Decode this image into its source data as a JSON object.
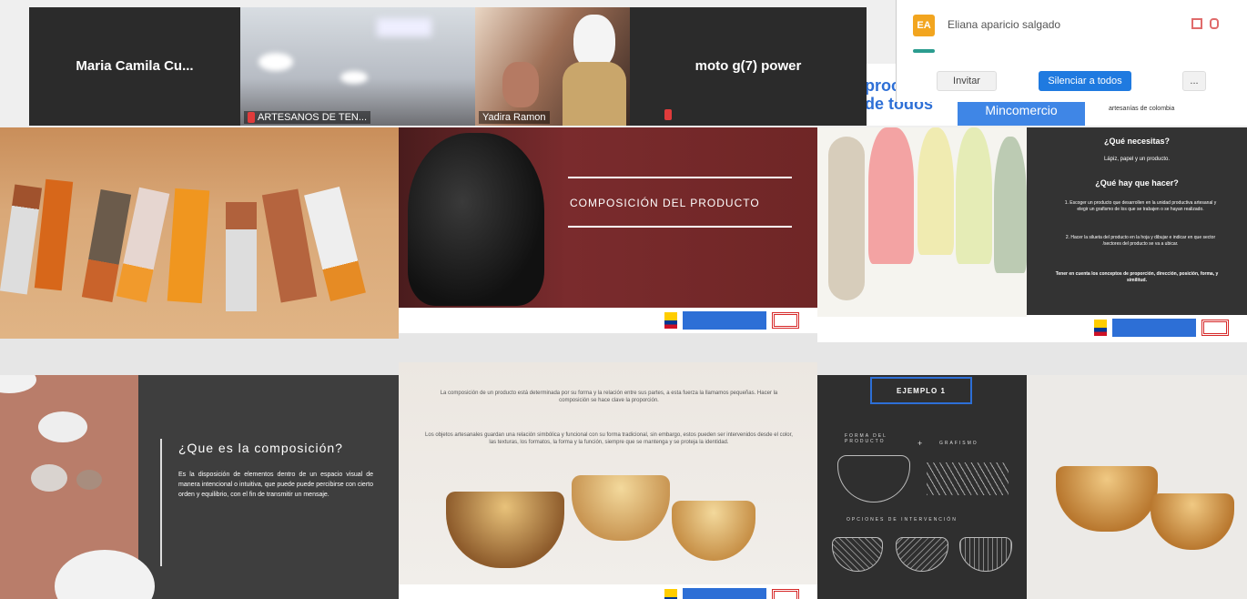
{
  "gallery": {
    "tiles": [
      {
        "name": "Maria Camila Cu..."
      },
      {
        "label": "ARTESANOS DE TEN..."
      },
      {
        "label": "Yadira Ramon"
      },
      {
        "name": "moto g(7) power"
      }
    ]
  },
  "participants": {
    "initials": "EA",
    "name": "Eliana aparicio salgado",
    "invite": "Invitar",
    "mute_all": "Silenciar a todos",
    "more": "..."
  },
  "behind": {
    "line1": "proc",
    "line2": "de todos",
    "tab": "Mincomercio",
    "small": "artesanías de colombia"
  },
  "slides": {
    "composicion_title": "COMPOSICIÓN DEL PRODUCTO",
    "que_necesitas": {
      "heading1": "¿Qué necesitas?",
      "line1": "Lápiz, papel y un producto.",
      "heading2": "¿Qué hay que hacer?",
      "step1": "1. Escoger un producto que desarrollen en la unidad productiva artesanal y elegir un grafismo de los que se trabajen o se hayan realizado.",
      "step2": "2. Hacer la silueta del producto en la hoja y dibujar e indicar en que sector /sectores del producto se va a ubicar.",
      "note": "Tener en cuenta los conceptos de proporción, dirección, posición, forma, y similitud."
    },
    "que_es": {
      "title": "¿Que es la composición?",
      "text": "Es la disposición de elementos dentro de un espacio visual de manera intencional o intuitiva, que puede puede percibirse con cierto orden y equilibrio, con el fin de transmitir un mensaje."
    },
    "bowls_text": {
      "p1": "La composición de un producto está determinada por su forma y la relación entre sus partes, a esta fuerza la llamamos pequeñas. Hacer la composición se hace clave la proporción.",
      "p2": "Los objetos artesanales guardan una relación simbólica y funcional con su forma tradicional, sin embargo, estos pueden ser intervenidos desde el color, las texturas, los formatos, la forma y la función, siempre que se mantenga y se proteja la identidad."
    },
    "ejemplo": {
      "tab": "EJEMPLO 1",
      "label1": "FORMA DEL PRODUCTO",
      "plus": "+",
      "label2": "GRAFISMO",
      "label3": "OPCIONES DE INTERVENCIÓN"
    }
  }
}
